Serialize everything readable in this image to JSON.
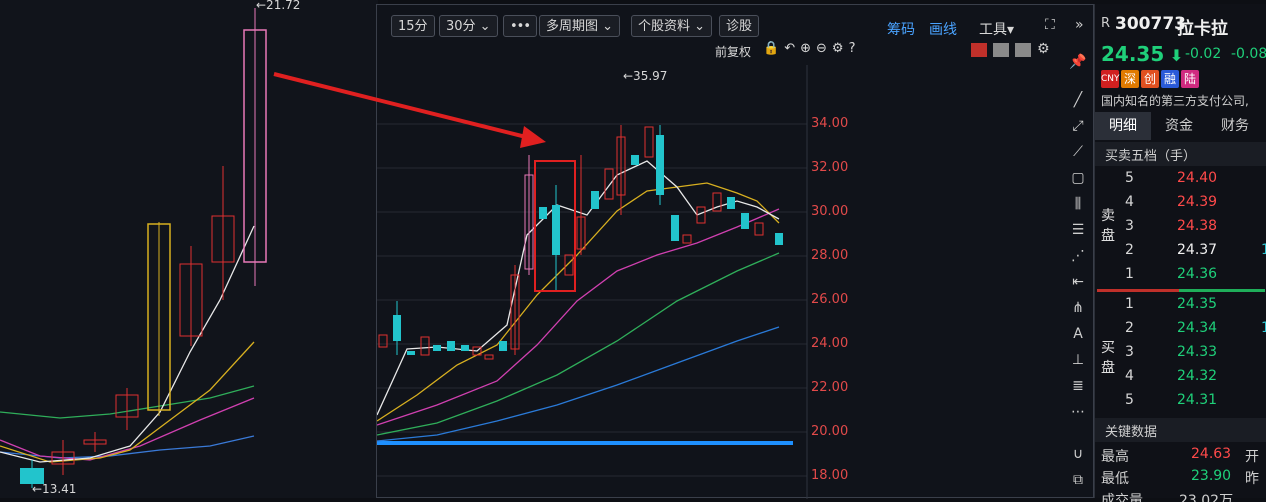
{
  "left_chart": {
    "high_label": "←21.72",
    "low_label": "←13.41"
  },
  "toolbar": {
    "period_15": "15分",
    "period_30": "30分 ⌄",
    "more": "•••",
    "multi_period": "多周期图 ⌄",
    "stock_info": "个股资料 ⌄",
    "diagnose": "诊股",
    "chips": "筹码",
    "draw": "画线",
    "tools": "工具▾",
    "adjust": "前复权"
  },
  "main_chart": {
    "peak_label": "←35.97",
    "y_ticks": [
      "34.00",
      "32.00",
      "30.00",
      "28.00",
      "26.00",
      "24.00",
      "22.00",
      "20.00",
      "18.00"
    ]
  },
  "stock": {
    "prefix": "R",
    "code": "300773",
    "name": "拉卡拉",
    "price": "24.35",
    "change": "-0.02",
    "change_pct": "-0.08",
    "tags": [
      "CNY",
      "深",
      "创",
      "融",
      "陆"
    ],
    "tag_colors": [
      "#d02020",
      "#e07a00",
      "#e05020",
      "#2a5ad8",
      "#d02a80"
    ],
    "industry": "国内知名的第三方支付公司,"
  },
  "tabs": [
    "明细",
    "资金",
    "财务"
  ],
  "order_book": {
    "title": "买卖五档（手）",
    "sell_label": "卖盘",
    "buy_label": "买盘",
    "sell": [
      {
        "level": "5",
        "price": "24.40",
        "cls": "red"
      },
      {
        "level": "4",
        "price": "24.39",
        "cls": "red"
      },
      {
        "level": "3",
        "price": "24.38",
        "cls": "red"
      },
      {
        "level": "2",
        "price": "24.37",
        "cls": "white"
      },
      {
        "level": "1",
        "price": "24.36",
        "cls": "green"
      }
    ],
    "buy": [
      {
        "level": "1",
        "price": "24.35",
        "cls": "green"
      },
      {
        "level": "2",
        "price": "24.34",
        "cls": "green"
      },
      {
        "level": "3",
        "price": "24.33",
        "cls": "green"
      },
      {
        "level": "4",
        "price": "24.32",
        "cls": "green"
      },
      {
        "level": "5",
        "price": "24.31",
        "cls": "green"
      }
    ]
  },
  "key_data": {
    "title": "关键数据",
    "high_label": "最高",
    "high_value": "24.63",
    "open_label": "开",
    "low_label": "最低",
    "low_value": "23.90",
    "prev_label": "昨",
    "volume_label": "成交量",
    "volume_value": "23.02万"
  }
}
